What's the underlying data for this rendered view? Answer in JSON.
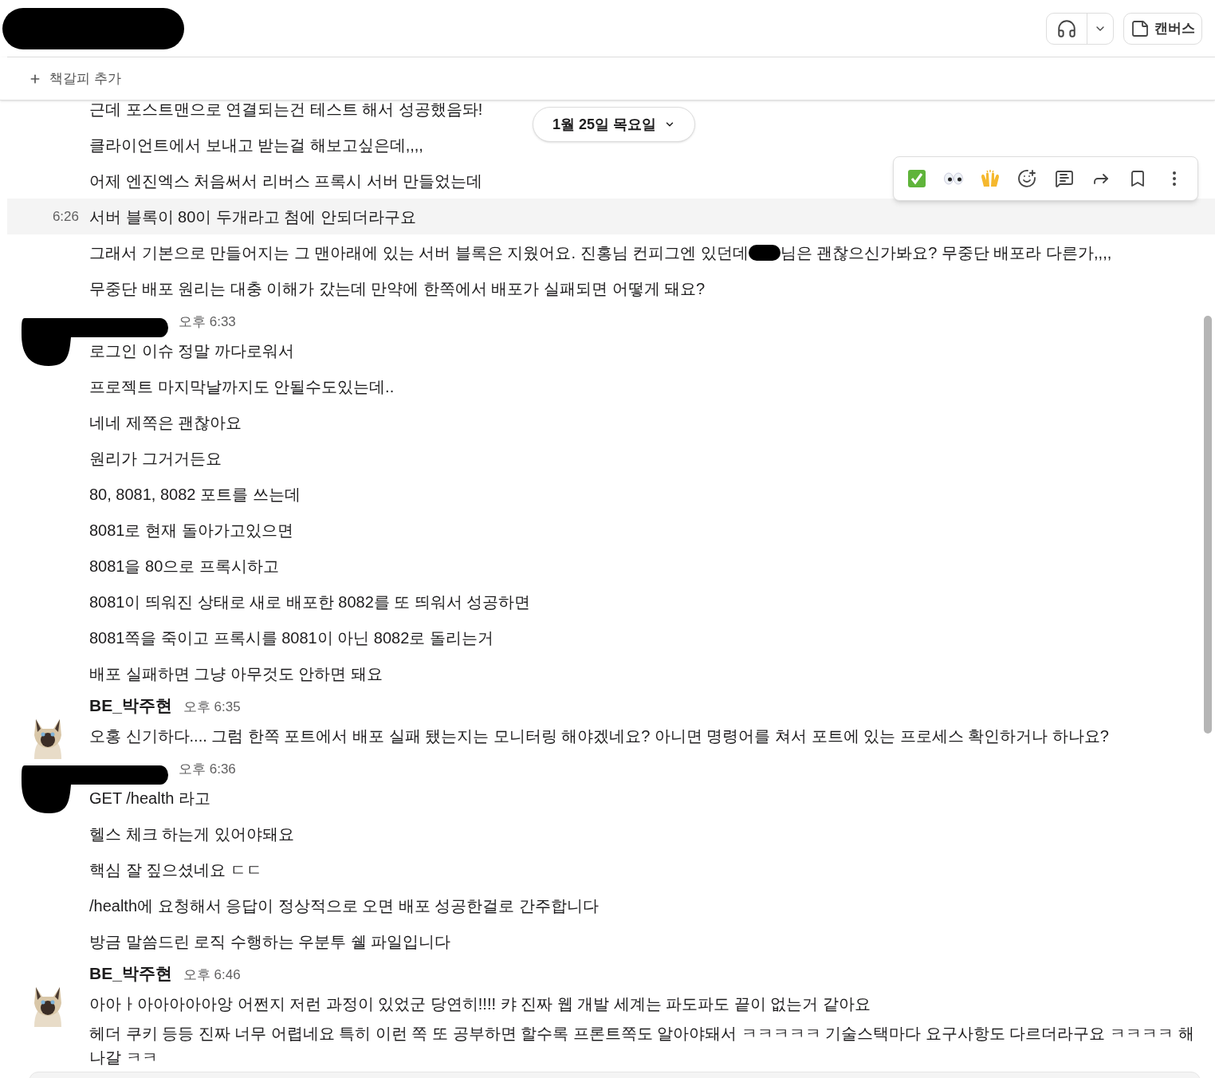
{
  "header": {
    "canvas_button": "캔버스"
  },
  "bookmark_bar": {
    "label": "책갈피 추가"
  },
  "date_divider": {
    "label": "1월 25일 목요일"
  },
  "hover_toolbar": {
    "actions": [
      {
        "kind": "check"
      },
      {
        "kind": "eyes"
      },
      {
        "kind": "hands"
      },
      {
        "kind": "add-reaction"
      },
      {
        "kind": "thread"
      },
      {
        "kind": "share"
      },
      {
        "kind": "bookmark"
      },
      {
        "kind": "more"
      }
    ]
  },
  "messages": [
    {
      "lines": [
        {
          "text": "근데 포스트맨으로 연결되는건 테스트 해서 성공했음돠!"
        },
        {
          "text": "클라이언트에서 보내고 받는걸 해보고싶은데,,,,"
        },
        {
          "text": "어제 엔진엑스 처음써서 리버스 프록시 서버 만들었는데"
        },
        {
          "text": "서버 블록이 80이 두개라고 첨에 안되더라구요",
          "hovered": true,
          "time": "6:26"
        },
        {
          "text": "그래서 기본으로 만들어지는 그 맨아래에 있는 서버 블록은 지웠어요. 진홍님 컨피그엔 있던데 ",
          "after": "님은 괜찮으신가봐요? 무중단 배포라 다른가,,,,"
        },
        {
          "text": "무중단 배포 원리는 대충 이해가 갔는데 만약에 한쪽에서 배포가 실패되면 어떻게 돼요?"
        }
      ]
    },
    {
      "time": "오후 6:33",
      "lines": [
        {
          "text": "로그인 이슈 정말 까다로워서"
        },
        {
          "text": "프로젝트 마지막날까지도 안될수도있는데.."
        },
        {
          "text": "네네 제쪽은 괜찮아요"
        },
        {
          "text": "원리가 그거거든요"
        },
        {
          "text": "80, 8081, 8082 포트를 쓰는데"
        },
        {
          "text": "8081로 현재 돌아가고있으면"
        },
        {
          "text": "8081을 80으로 프록시하고"
        },
        {
          "text": "8081이 띄워진 상태로 새로 배포한 8082를 또 띄워서 성공하면"
        },
        {
          "text": "8081쪽을 죽이고 프록시를 8081이 아닌 8082로 돌리는거"
        },
        {
          "text": "배포 실패하면 그냥 아무것도 안하면 돼요"
        }
      ]
    },
    {
      "author": "BE_박주현",
      "time": "오후 6:35",
      "lines": [
        {
          "text": "오홍 신기하다.... 그럼 한쪽 포트에서 배포 실패 됐는지는 모니터링 해야겠네요? 아니면 명령어를 쳐서 포트에 있는 프로세스 확인하거나 하나요?"
        }
      ]
    },
    {
      "time": "오후 6:36",
      "lines": [
        {
          "text": "GET /health 라고"
        },
        {
          "text": "헬스 체크 하는게 있어야돼요"
        },
        {
          "text": "핵심 잘 짚으셨네요 ㄷㄷ"
        },
        {
          "text": "/health에 요청해서 응답이 정상적으로 오면 배포 성공한걸로 간주합니다"
        },
        {
          "text": "방금 말씀드린 로직 수행하는 우분투 쉘 파일입니다"
        }
      ]
    },
    {
      "author": "BE_박주현",
      "time": "오후 6:46",
      "lines": [
        {
          "text": "아아ㅏ아아아아아앙 어쩐지 저런 과정이 있었군 당연히!!!! 캬 진짜 웹 개발 세계는 파도파도 끝이 없는거 같아요"
        },
        {
          "text": "헤더 쿠키 등등 진짜 너무 어렵네요 특히 이런 쪽 또 공부하면 할수록 프론트쪽도 알아야돼서 ㅋㅋㅋㅋㅋ 기술스택마다 요구사항도 다르더라구요 ㅋㅋㅋㅋ 해나갈 ㅋㅋ"
        }
      ]
    }
  ]
}
